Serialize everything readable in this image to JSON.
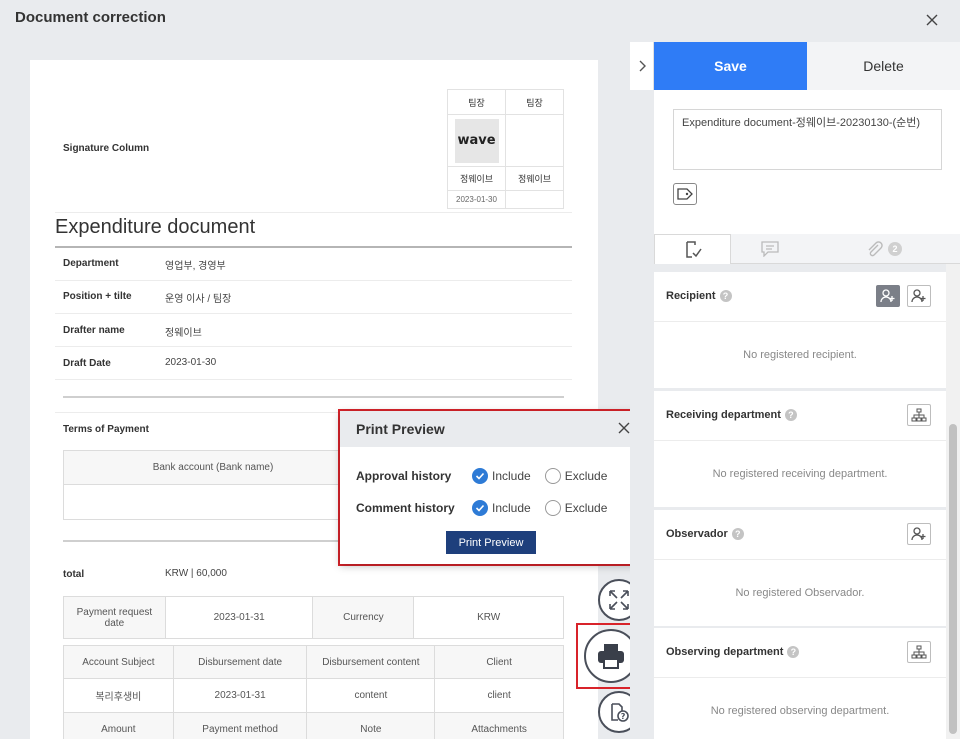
{
  "window": {
    "title": "Document correction"
  },
  "document": {
    "signature_label": "Signature Column",
    "signature": {
      "headers": [
        "팀장",
        "팀장"
      ],
      "stamp_text": "wave",
      "names": [
        "정웨이브",
        "정웨이브"
      ],
      "dates": [
        "2023-01-30",
        ""
      ]
    },
    "title": "Expenditure document",
    "fields": [
      {
        "label": "Department",
        "value": "영업부, 경영부"
      },
      {
        "label": "Position + tilte",
        "value": "운영 이사 / 팀장"
      },
      {
        "label": "Drafter name",
        "value": "정웨이브"
      },
      {
        "label": "Draft Date",
        "value": "2023-01-30"
      }
    ],
    "terms_label": "Terms of Payment",
    "bank_header": "Bank account (Bank name)",
    "total_label": "total",
    "total_value": "KRW | 60,000",
    "payment_row": [
      "Payment request date",
      "2023-01-31",
      "Currency",
      "KRW"
    ],
    "items_header": [
      "Account Subject",
      "Disbursement date",
      "Disbursement content",
      "Client"
    ],
    "items_row": [
      "복리후생비",
      "2023-01-31",
      "content",
      "client"
    ],
    "items_header2": [
      "Amount",
      "Payment method",
      "Note",
      "Attachments"
    ]
  },
  "modal": {
    "title": "Print Preview",
    "rows": [
      {
        "label": "Approval history",
        "include": "Include",
        "exclude": "Exclude",
        "selected": "include"
      },
      {
        "label": "Comment history",
        "include": "Include",
        "exclude": "Exclude",
        "selected": "include"
      }
    ],
    "button": "Print Preview"
  },
  "sidebar": {
    "save_label": "Save",
    "delete_label": "Delete",
    "doc_title_value": "Expenditure document-정웨이브-20230130-(순번)",
    "attachments_count": "2",
    "sections": [
      {
        "title": "Recipient",
        "empty": "No registered recipient."
      },
      {
        "title": "Receiving department",
        "empty": "No registered receiving department."
      },
      {
        "title": "Observador",
        "empty": "No registered Observador."
      },
      {
        "title": "Observing department",
        "empty": "No registered observing department."
      }
    ]
  },
  "colors": {
    "accent": "#2f7cf6",
    "highlight": "#d8232a",
    "modal_button": "#1e3f7c"
  }
}
